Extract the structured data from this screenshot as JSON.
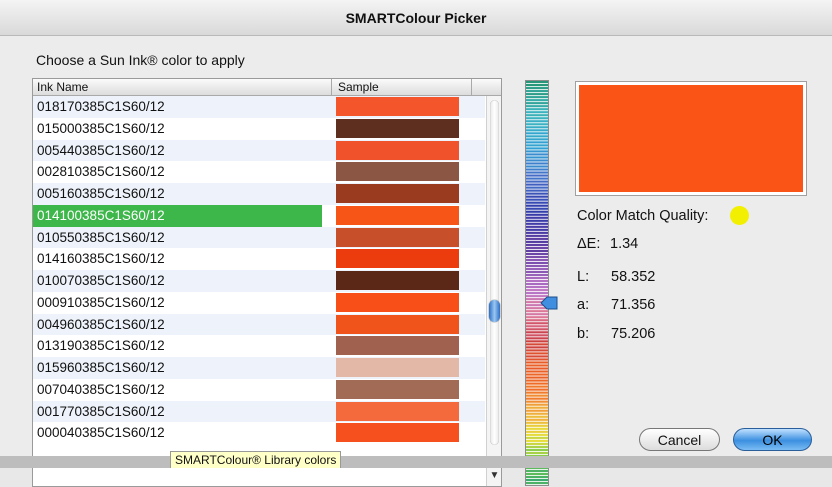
{
  "window": {
    "title": "SMARTColour Picker"
  },
  "prompt": "Choose a Sun Ink® color to apply",
  "table": {
    "columns": [
      "Ink Name",
      "Sample"
    ],
    "rows": [
      {
        "name": "018170385C1S60/12",
        "color": "#f4552a"
      },
      {
        "name": "015000385C1S60/12",
        "color": "#5e2e1e"
      },
      {
        "name": "005440385C1S60/12",
        "color": "#f0522b"
      },
      {
        "name": "002810385C1S60/12",
        "color": "#8c5645"
      },
      {
        "name": "005160385C1S60/12",
        "color": "#9a3a1e"
      },
      {
        "name": "014100385C1S60/12",
        "color": "#f75417",
        "selected": true
      },
      {
        "name": "010550385C1S60/12",
        "color": "#c7502a"
      },
      {
        "name": "014160385C1S60/12",
        "color": "#ec3b0c"
      },
      {
        "name": "010070385C1S60/12",
        "color": "#5b2817"
      },
      {
        "name": "000910385C1S60/12",
        "color": "#f74f17"
      },
      {
        "name": "004960385C1S60/12",
        "color": "#f0541a"
      },
      {
        "name": "013190385C1S60/12",
        "color": "#a0614e"
      },
      {
        "name": "015960385C1S60/12",
        "color": "#e4b8a6"
      },
      {
        "name": "007040385C1S60/12",
        "color": "#a26b56"
      },
      {
        "name": "001770385C1S60/12",
        "color": "#f56a3c"
      },
      {
        "name": "000040385C1S60/12",
        "color": "#f5501e"
      }
    ],
    "selected_color": "#3db64a"
  },
  "scrollbar": {
    "position": 0.62
  },
  "preview": {
    "color": "#fa5517"
  },
  "quality": {
    "label": "Color Match Quality:",
    "indicator_color": "#f2f000"
  },
  "metrics": {
    "delta_e": {
      "label": "ΔE:",
      "value": "1.34"
    },
    "L": {
      "label": "L:",
      "value": "58.352"
    },
    "a": {
      "label": "a:",
      "value": "71.356"
    },
    "b": {
      "label": "b:",
      "value": "75.206"
    }
  },
  "buttons": {
    "cancel": "Cancel",
    "ok": "OK"
  },
  "tooltip": "SMARTColour® Library colors",
  "icons": {
    "scroll_up": "scroll-up-arrow-icon",
    "scroll_down": "scroll-down-arrow-icon",
    "ramp_marker": "ramp-marker-icon"
  }
}
